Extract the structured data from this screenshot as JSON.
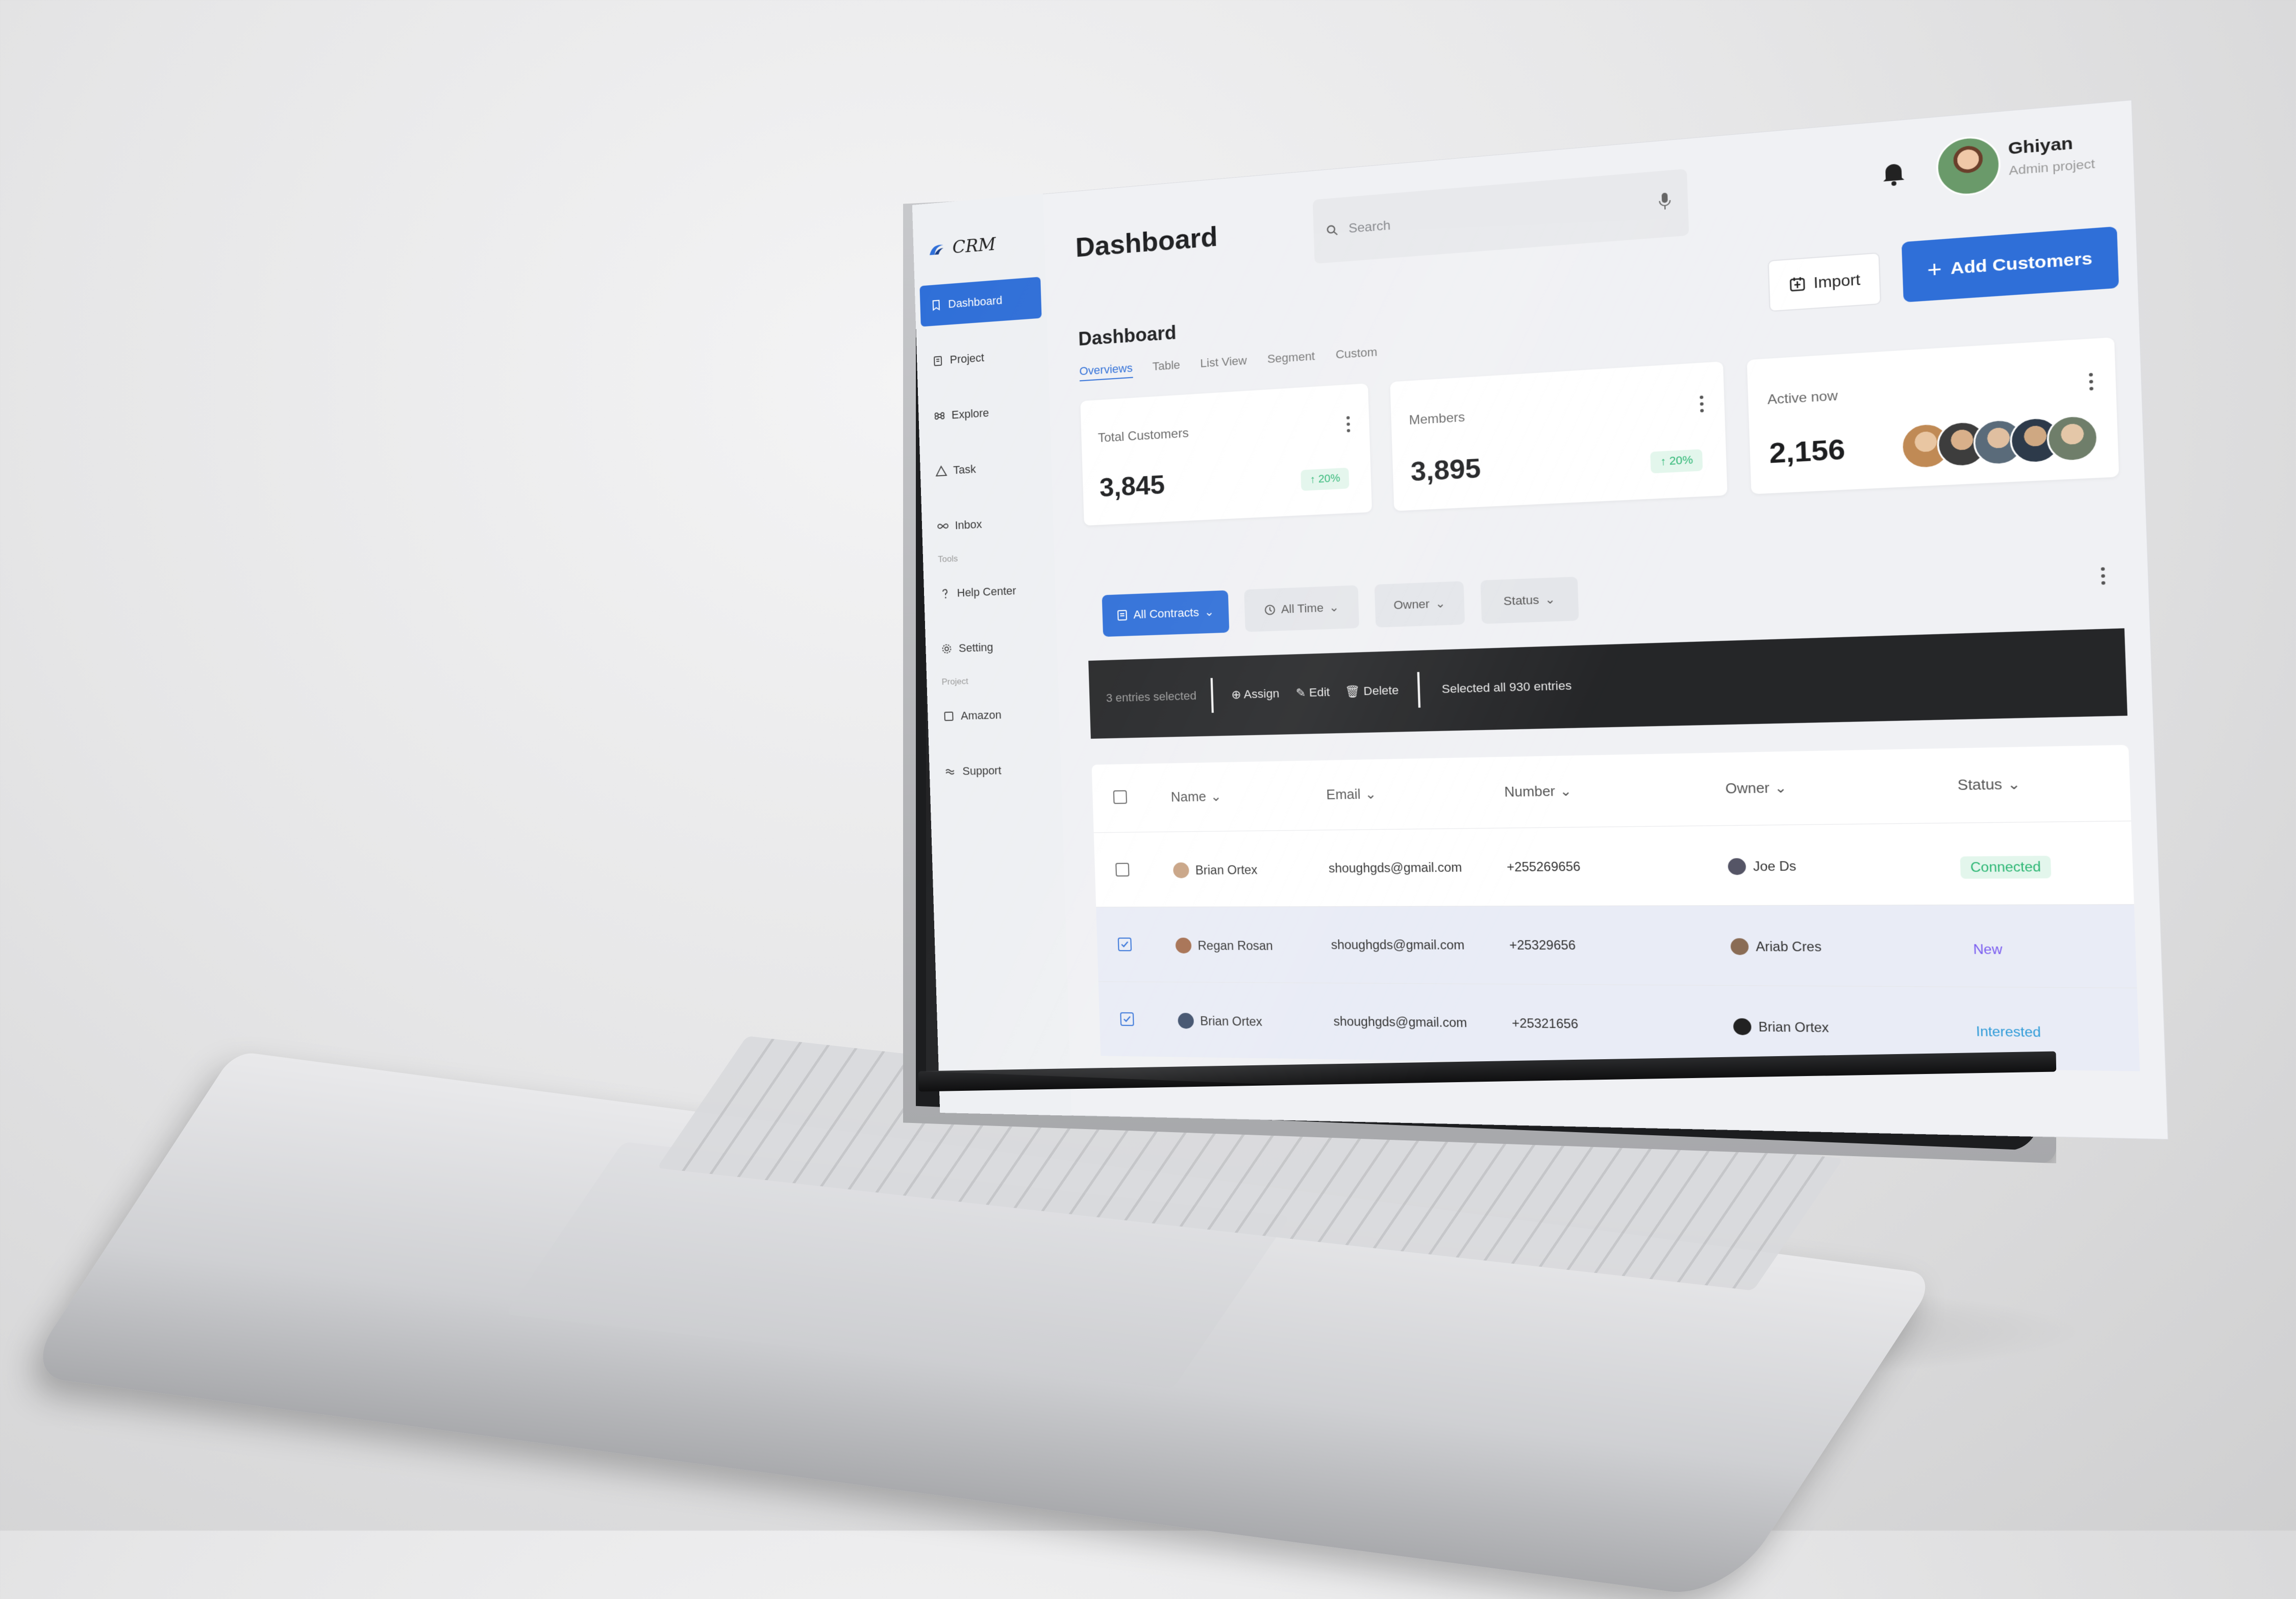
{
  "app": {
    "logo": "CRM",
    "page_title": "Dashboard",
    "search_placeholder": "Search",
    "user": {
      "name": "Ghiyan",
      "role": "Admin project"
    },
    "buttons": {
      "import": "Import",
      "add_customers": "Add Customers"
    }
  },
  "sidebar": {
    "items": [
      {
        "label": "Dashboard",
        "icon": "bookmark-icon",
        "active": true
      },
      {
        "label": "Project",
        "icon": "clipboard-icon"
      },
      {
        "label": "Explore",
        "icon": "command-icon"
      },
      {
        "label": "Task",
        "icon": "triangle-icon"
      },
      {
        "label": "Inbox",
        "icon": "infinity-icon"
      }
    ],
    "tools_title": "Tools",
    "tools": [
      {
        "label": "Help Center",
        "icon": "question-icon"
      },
      {
        "label": "Setting",
        "icon": "gear-icon"
      }
    ],
    "project_title": "Project",
    "projects": [
      {
        "label": "Amazon",
        "icon": "square-icon"
      },
      {
        "label": "Support",
        "icon": "wave-icon"
      }
    ]
  },
  "main": {
    "section_title": "Dashboard",
    "tabs": [
      "Overviews",
      "Table",
      "List View",
      "Segment",
      "Custom"
    ],
    "cards": [
      {
        "label": "Total Customers",
        "value": "3,845",
        "badge": "↑ 20%"
      },
      {
        "label": "Members",
        "value": "3,895",
        "badge": "↑ 20%"
      },
      {
        "label": "Active now",
        "value": "2,156"
      }
    ],
    "filters": [
      "All Contracts",
      "All Time",
      "Owner",
      "Status"
    ],
    "bulk": {
      "selected": "3 entries selected",
      "assign": "Assign",
      "edit": "Edit",
      "delete": "Delete",
      "selected_all": "Selected all 930 entries"
    },
    "table": {
      "columns": [
        "Name",
        "Email",
        "Number",
        "Owner",
        "Status"
      ],
      "rows": [
        {
          "name": "Brian Ortex",
          "email": "shoughgds@gmail.com",
          "number": "+255269656",
          "owner": "Joe Ds",
          "status": "Connected",
          "checked": false
        },
        {
          "name": "Regan Rosan",
          "email": "shoughgds@gmail.com",
          "number": "+25329656",
          "owner": "Ariab Cres",
          "status": "New",
          "checked": true
        },
        {
          "name": "Brian Ortex",
          "email": "shoughgds@gmail.com",
          "number": "+25321656",
          "owner": "Brian Ortex",
          "status": "Interested",
          "checked": true
        }
      ]
    }
  },
  "colors": {
    "accent": "#2f6fd8",
    "connected": "#2bb673",
    "new": "#7a5cf0",
    "interested": "#2f9bd8"
  }
}
